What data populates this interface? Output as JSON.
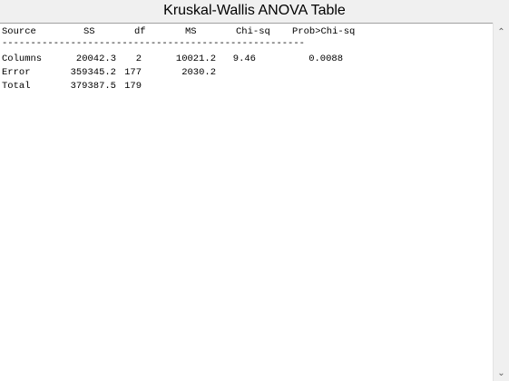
{
  "window": {
    "title": "Kruskal-Wallis ANOVA Table"
  },
  "table": {
    "headers": [
      "Source",
      "SS",
      "df",
      "MS",
      "Chi-sq",
      "Prob>Chi-sq"
    ],
    "separator": "-----------------------------------------------------",
    "rows": [
      [
        "Columns",
        "20042.3",
        "2",
        "10021.2",
        "9.46",
        "0.0088"
      ],
      [
        "Error",
        "359345.2",
        "177",
        "2030.2",
        "",
        ""
      ],
      [
        "Total",
        "379387.5",
        "179",
        "",
        "",
        ""
      ]
    ]
  },
  "scrollbar": {
    "up_icon": "chevron-up-icon",
    "down_icon": "chevron-down-icon"
  }
}
